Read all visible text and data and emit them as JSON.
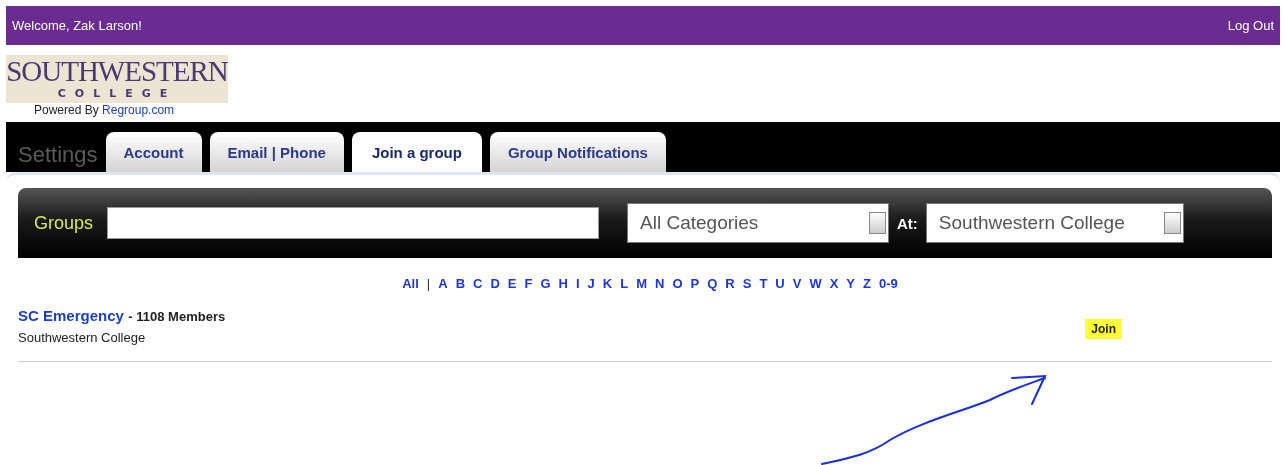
{
  "top_bar": {
    "welcome": "Welcome, Zak Larson!",
    "logout": "Log Out"
  },
  "logo": {
    "name": "SOUTHWESTERN",
    "sub": "COLLEGE"
  },
  "powered_by": {
    "text": "Powered By",
    "link": "Regroup.com"
  },
  "settings_label": "Settings",
  "tabs": [
    {
      "label": "Account",
      "selected": false
    },
    {
      "label": "Email | Phone",
      "selected": false
    },
    {
      "label": "Join a group",
      "selected": true
    },
    {
      "label": "Group Notifications",
      "selected": false
    }
  ],
  "search_bar": {
    "label": "Groups",
    "category": "All Categories",
    "at_label": "At:",
    "location": "Southwestern College"
  },
  "letters": [
    "All",
    "|",
    "A",
    "B",
    "C",
    "D",
    "E",
    "F",
    "G",
    "H",
    "I",
    "J",
    "K",
    "L",
    "M",
    "N",
    "O",
    "P",
    "Q",
    "R",
    "S",
    "T",
    "U",
    "V",
    "W",
    "X",
    "Y",
    "Z",
    "0-9"
  ],
  "groups": [
    {
      "name": "SC Emergency",
      "members": "- 1108 Members",
      "location": "Southwestern College",
      "action": "Join"
    }
  ]
}
